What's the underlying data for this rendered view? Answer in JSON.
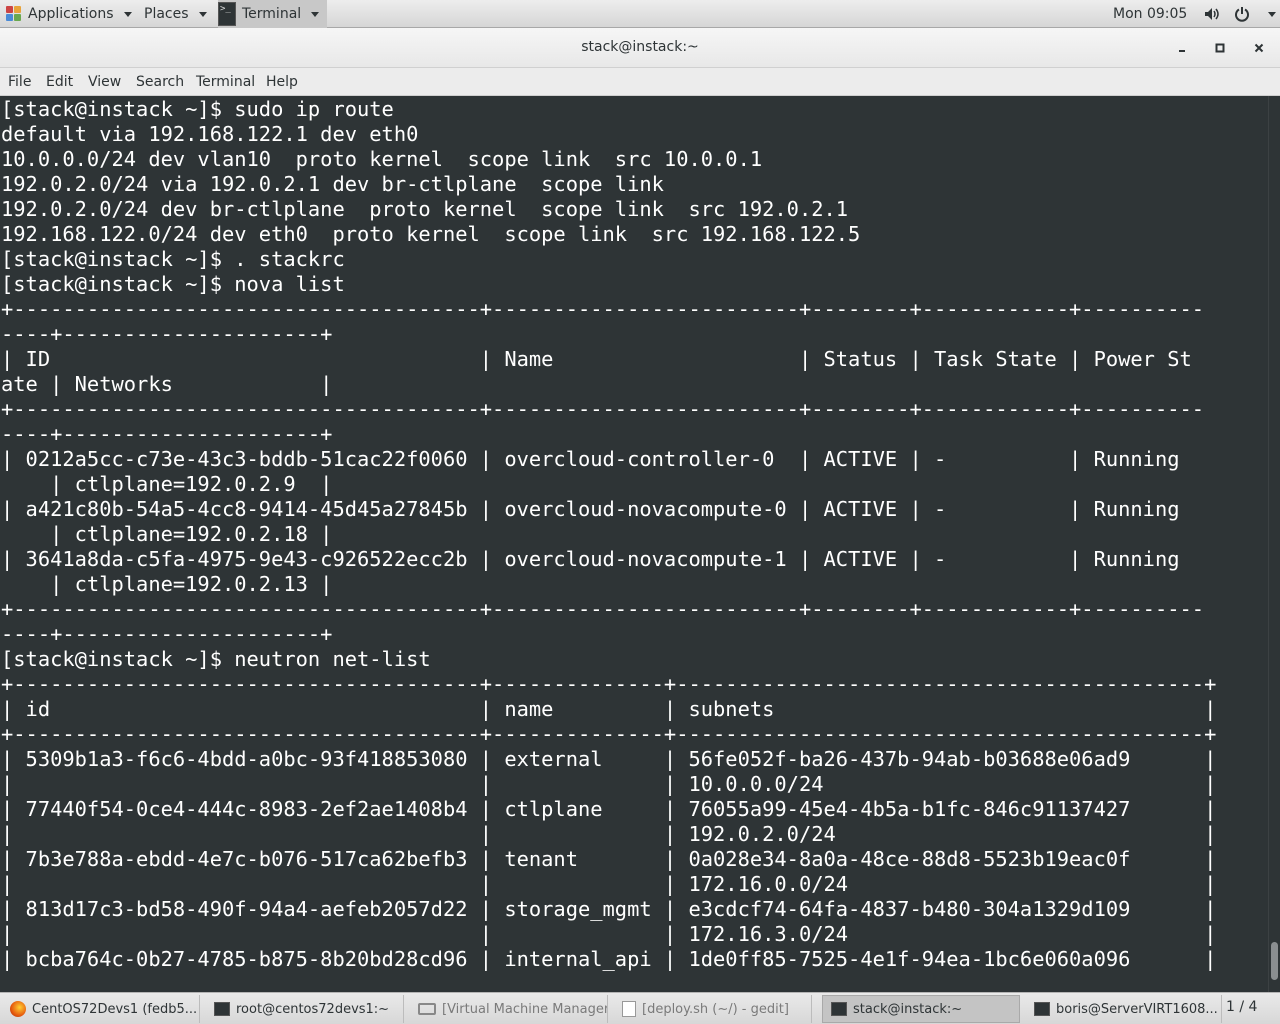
{
  "top_panel": {
    "applications": "Applications",
    "places": "Places",
    "terminal": "Terminal",
    "clock": "Mon 09:05",
    "icons": [
      "volume-icon",
      "power-icon"
    ]
  },
  "window": {
    "title": "stack@instack:~",
    "controls": [
      "minimize-icon",
      "maximize-icon",
      "close-icon"
    ]
  },
  "menu_bar": {
    "items": [
      "File",
      "Edit",
      "View",
      "Search",
      "Terminal",
      "Help"
    ]
  },
  "terminal": {
    "lines": [
      "[stack@instack ~]$ sudo ip route",
      "default via 192.168.122.1 dev eth0",
      "10.0.0.0/24 dev vlan10  proto kernel  scope link  src 10.0.0.1",
      "192.0.2.0/24 via 192.0.2.1 dev br-ctlplane  scope link",
      "192.0.2.0/24 dev br-ctlplane  proto kernel  scope link  src 192.0.2.1",
      "192.168.122.0/24 dev eth0  proto kernel  scope link  src 192.168.122.5",
      "[stack@instack ~]$ . stackrc",
      "[stack@instack ~]$ nova list",
      "+--------------------------------------+-------------------------+--------+------------+----------",
      "----+---------------------+",
      "| ID                                   | Name                    | Status | Task State | Power St",
      "ate | Networks            |",
      "+--------------------------------------+-------------------------+--------+------------+----------",
      "----+---------------------+",
      "| 0212a5cc-c73e-43c3-bddb-51cac22f0060 | overcloud-controller-0  | ACTIVE | -          | Running",
      "    | ctlplane=192.0.2.9  |",
      "| a421c80b-54a5-4cc8-9414-45d45a27845b | overcloud-novacompute-0 | ACTIVE | -          | Running",
      "    | ctlplane=192.0.2.18 |",
      "| 3641a8da-c5fa-4975-9e43-c926522ecc2b | overcloud-novacompute-1 | ACTIVE | -          | Running",
      "    | ctlplane=192.0.2.13 |",
      "+--------------------------------------+-------------------------+--------+------------+----------",
      "----+---------------------+",
      "[stack@instack ~]$ neutron net-list",
      "+--------------------------------------+--------------+-------------------------------------------+",
      "| id                                   | name         | subnets                                   |",
      "+--------------------------------------+--------------+-------------------------------------------+",
      "| 5309b1a3-f6c6-4bdd-a0bc-93f418853080 | external     | 56fe052f-ba26-437b-94ab-b03688e06ad9      |",
      "|                                      |              | 10.0.0.0/24                               |",
      "| 77440f54-0ce4-444c-8983-2ef2ae1408b4 | ctlplane     | 76055a99-45e4-4b5a-b1fc-846c91137427      |",
      "|                                      |              | 192.0.2.0/24                              |",
      "| 7b3e788a-ebdd-4e7c-b076-517ca62befb3 | tenant       | 0a028e34-8a0a-48ce-88d8-5523b19eac0f      |",
      "|                                      |              | 172.16.0.0/24                             |",
      "| 813d17c3-bd58-490f-94a4-aefeb2057d22 | storage_mgmt | e3cdcf74-64fa-4837-b480-304a1329d109      |",
      "|                                      |              | 172.16.3.0/24                             |",
      "| bcba764c-0b27-4785-b875-8b20bd28cd96 | internal_api | 1de0ff85-7525-4e1f-94ea-1bc6e060a096      |"
    ]
  },
  "taskbar": {
    "tasks": [
      {
        "label": "CentOS72Devs1 (fedb5...",
        "icon": "firefox-icon"
      },
      {
        "label": "root@centos72devs1:~",
        "icon": "terminal-icon"
      },
      {
        "label": "[Virtual Machine Manager]",
        "icon": "vm-manager-icon"
      },
      {
        "label": "[deploy.sh (~/) - gedit]",
        "icon": "gedit-icon"
      },
      {
        "label": "stack@instack:~",
        "icon": "terminal-icon"
      },
      {
        "label": "boris@ServerVIRT1608...",
        "icon": "terminal-icon"
      }
    ],
    "workspace": "1 / 4"
  }
}
